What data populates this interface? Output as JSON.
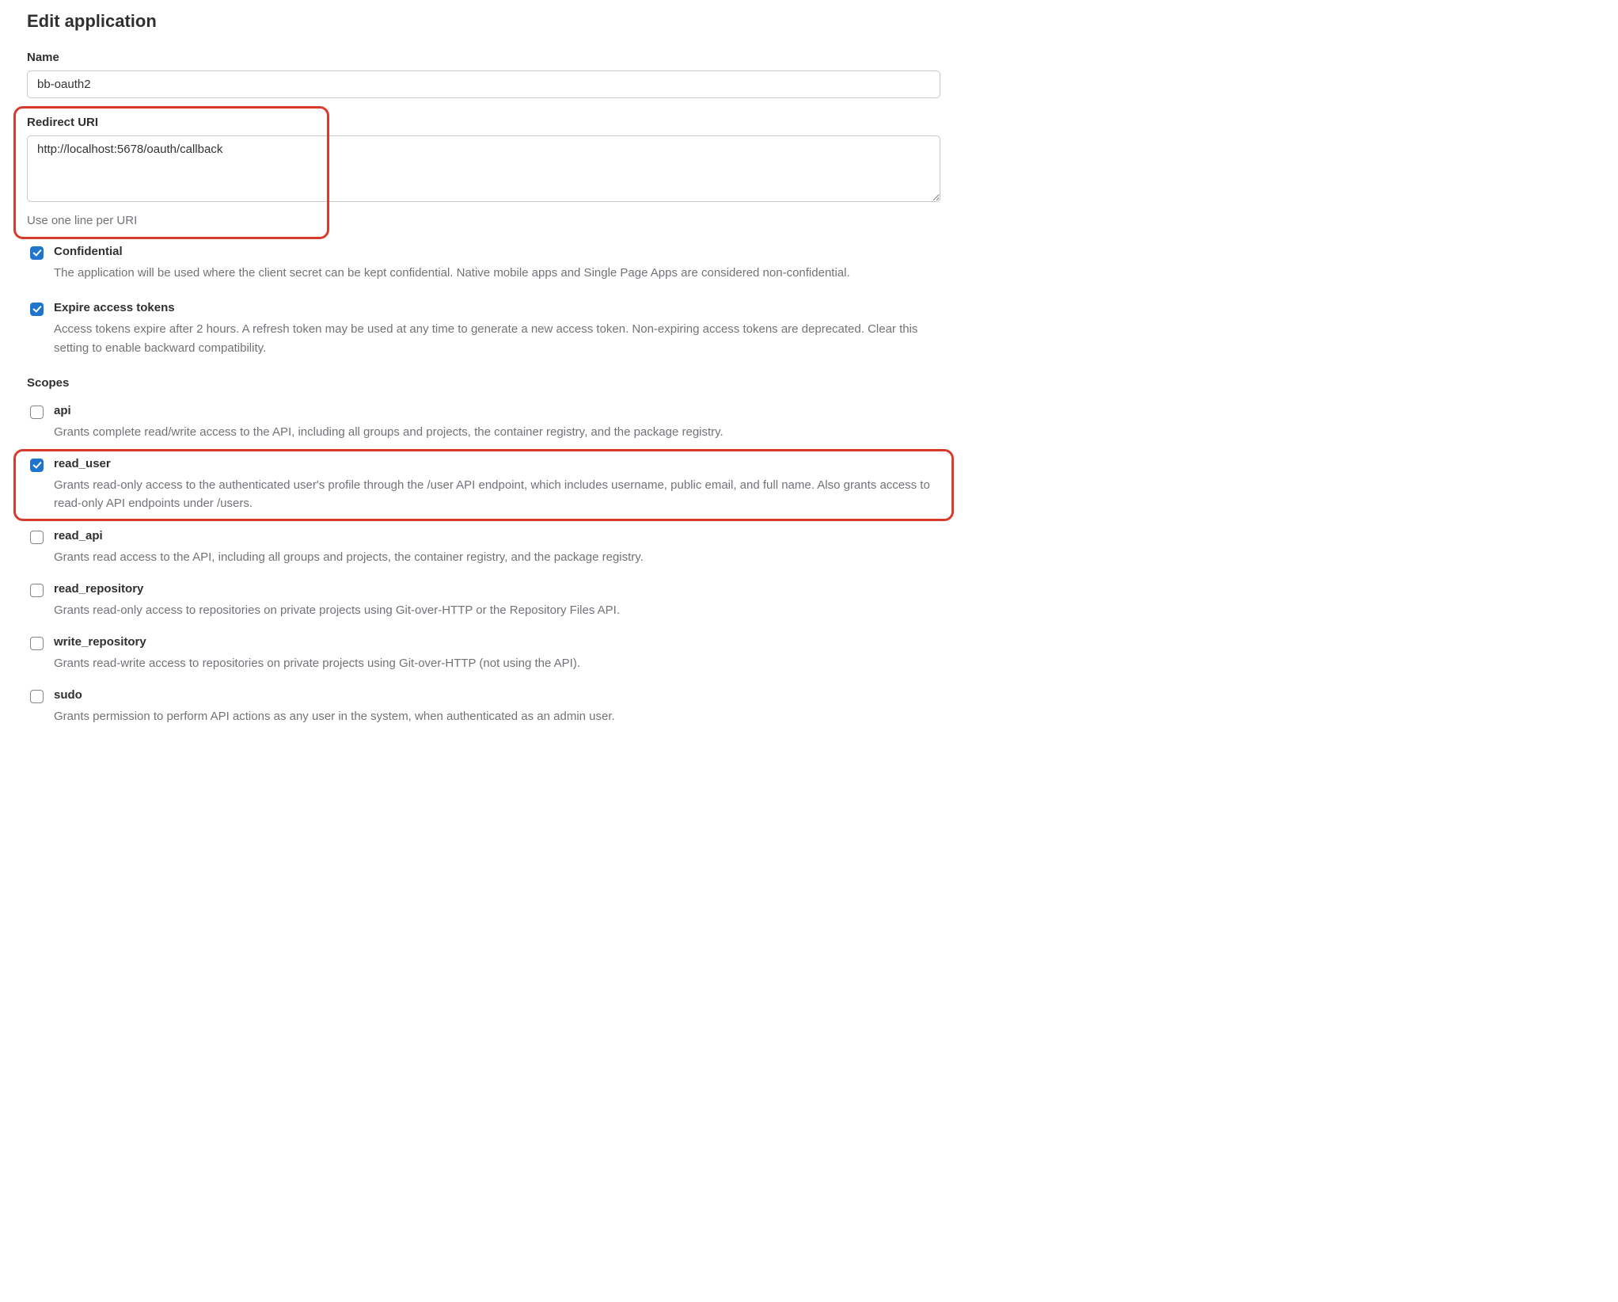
{
  "page_title": "Edit application",
  "name_field": {
    "label": "Name",
    "value": "bb-oauth2"
  },
  "redirect_field": {
    "label": "Redirect URI",
    "value": "http://localhost:5678/oauth/callback",
    "help": "Use one line per URI"
  },
  "confidential": {
    "label": "Confidential",
    "checked": true,
    "description": "The application will be used where the client secret can be kept confidential. Native mobile apps and Single Page Apps are considered non-confidential."
  },
  "expire_tokens": {
    "label": "Expire access tokens",
    "checked": true,
    "description": "Access tokens expire after 2 hours. A refresh token may be used at any time to generate a new access token. Non-expiring access tokens are deprecated. Clear this setting to enable backward compatibility."
  },
  "scopes_heading": "Scopes",
  "scopes": [
    {
      "key": "api",
      "label": "api",
      "checked": false,
      "highlighted": false,
      "description": "Grants complete read/write access to the API, including all groups and projects, the container registry, and the package registry."
    },
    {
      "key": "read_user",
      "label": "read_user",
      "checked": true,
      "highlighted": true,
      "description": "Grants read-only access to the authenticated user's profile through the /user API endpoint, which includes username, public email, and full name. Also grants access to read-only API endpoints under /users."
    },
    {
      "key": "read_api",
      "label": "read_api",
      "checked": false,
      "highlighted": false,
      "description": "Grants read access to the API, including all groups and projects, the container registry, and the package registry."
    },
    {
      "key": "read_repository",
      "label": "read_repository",
      "checked": false,
      "highlighted": false,
      "description": "Grants read-only access to repositories on private projects using Git-over-HTTP or the Repository Files API."
    },
    {
      "key": "write_repository",
      "label": "write_repository",
      "checked": false,
      "highlighted": false,
      "description": "Grants read-write access to repositories on private projects using Git-over-HTTP (not using the API)."
    },
    {
      "key": "sudo",
      "label": "sudo",
      "checked": false,
      "highlighted": false,
      "description": "Grants permission to perform API actions as any user in the system, when authenticated as an admin user."
    }
  ],
  "highlight_color": "#d93b2b"
}
